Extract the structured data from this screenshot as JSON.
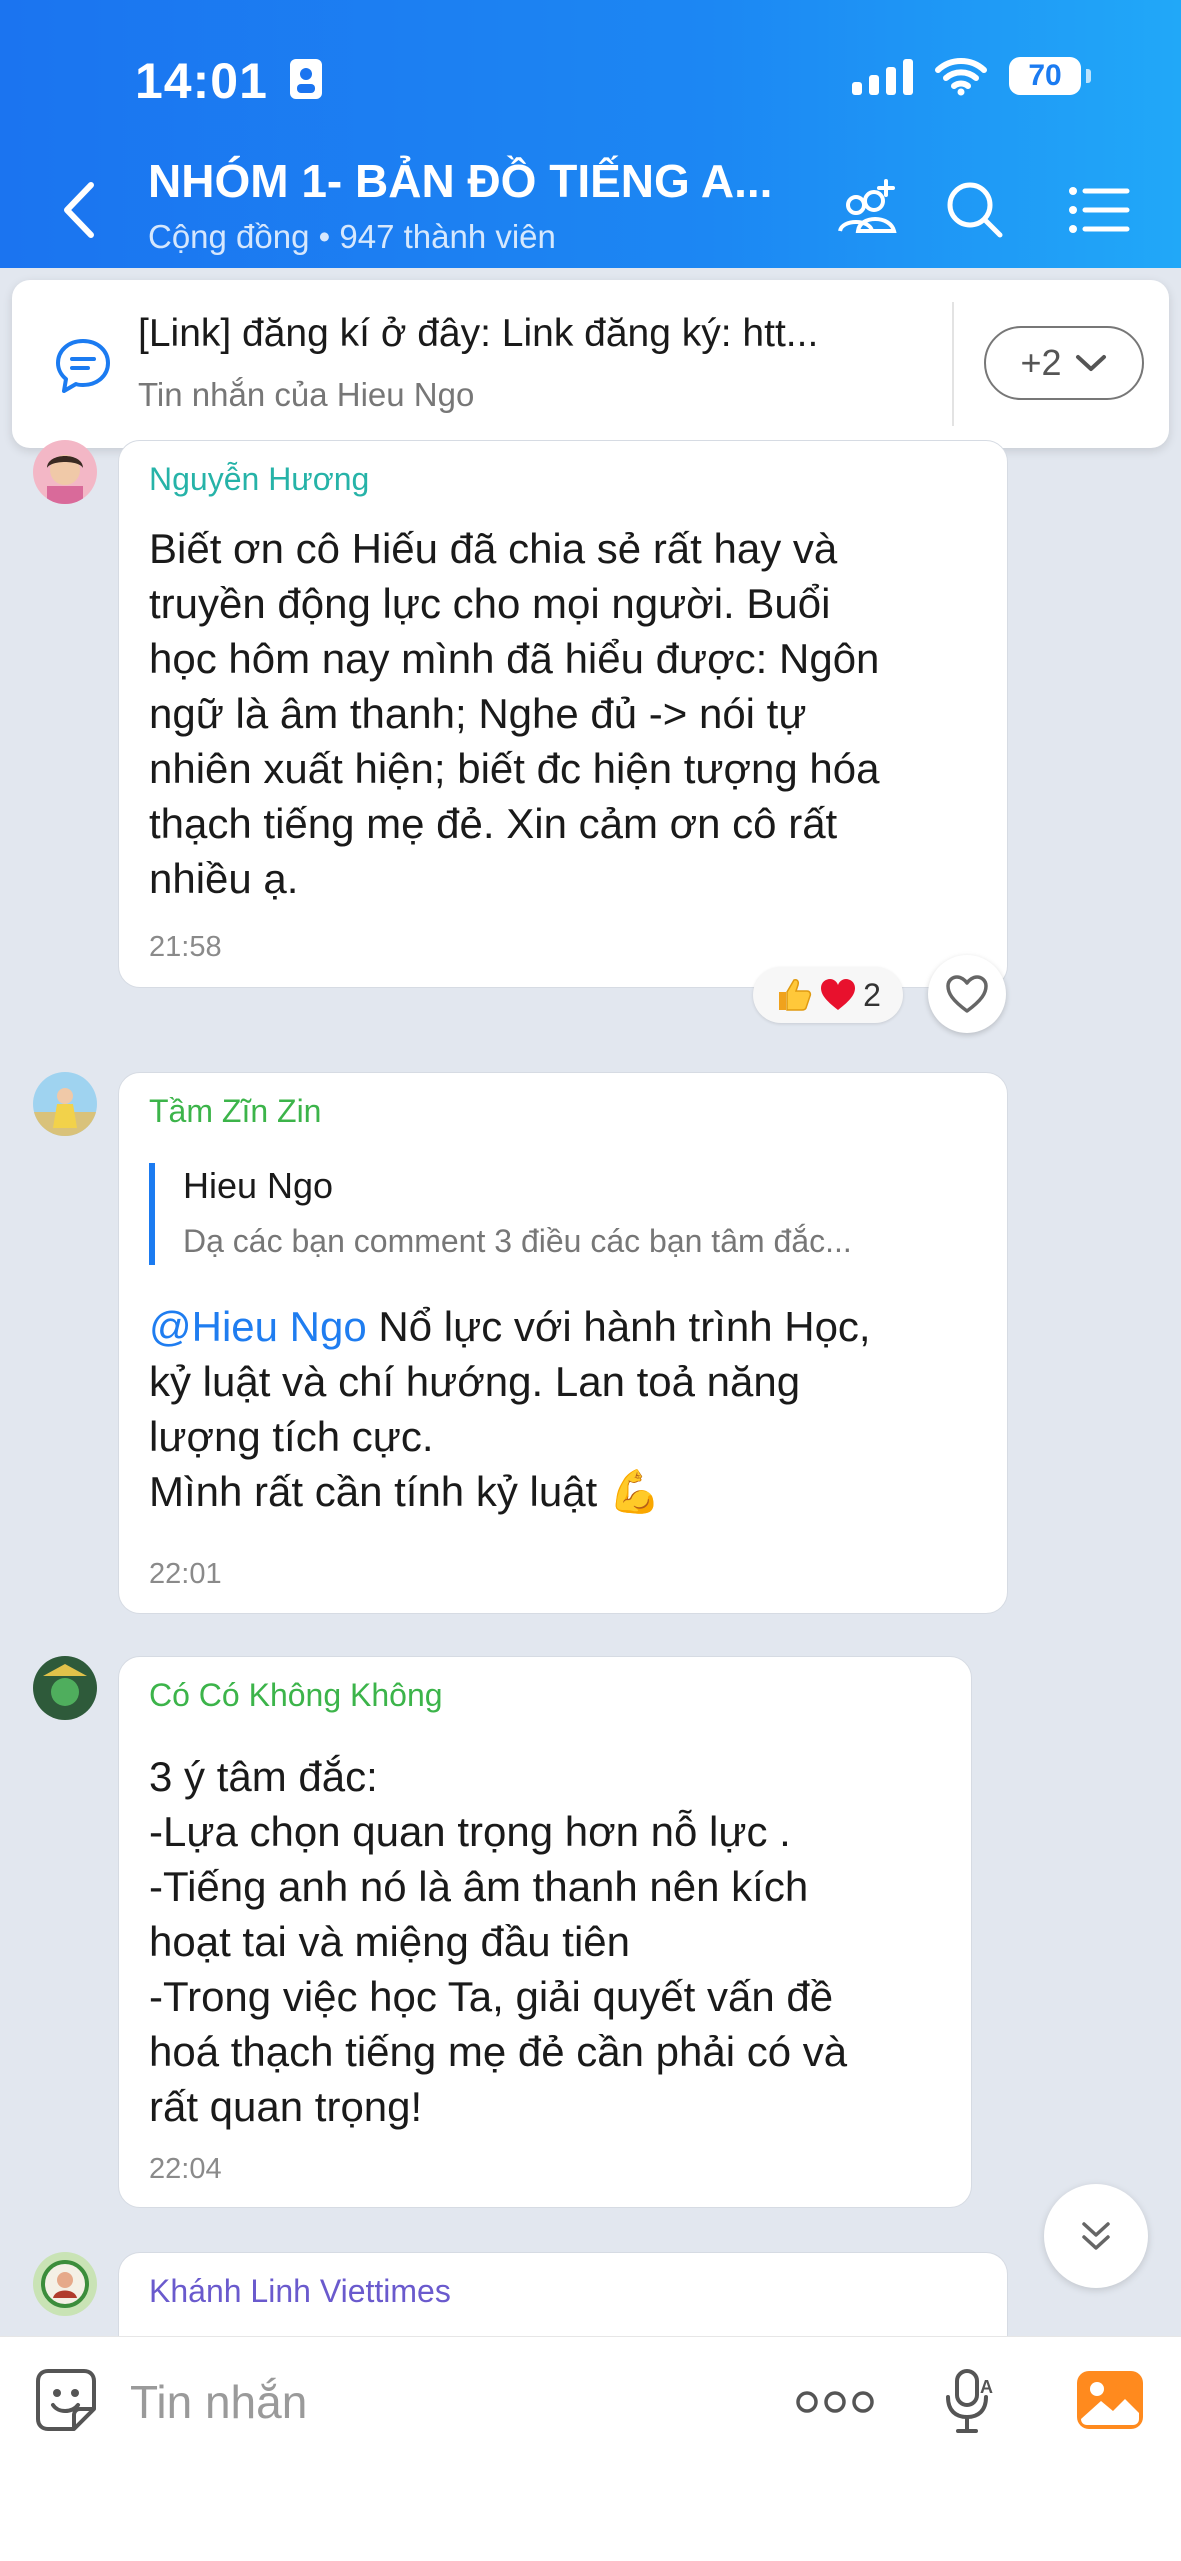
{
  "status_bar": {
    "time": "14:01",
    "battery": "70"
  },
  "header": {
    "title": "NHÓM 1- BẢN ĐỒ TIẾNG A...",
    "subtitle": "Cộng đồng • 947 thành viên"
  },
  "pinned": {
    "title": "[Link] đăng kí ở đây: Link đăng ký: htt...",
    "subtitle": "Tin nhắn của Hieu Ngo",
    "more_label": "+2"
  },
  "messages": [
    {
      "sender": "Nguyễn Hương",
      "lines": [
        "Biết ơn cô Hiếu đã chia sẻ rất hay và",
        "truyền động lực cho mọi người. Buổi",
        "học hôm nay mình đã hiểu được:  Ngôn",
        "ngữ là âm thanh;  Nghe đủ -> nói tự",
        "nhiên xuất hiện; biết đc hiện tượng hóa",
        "thạch tiếng mẹ đẻ. Xin cảm ơn cô rất",
        "nhiều ạ."
      ],
      "time": "21:58",
      "reaction_count": "2"
    },
    {
      "sender": "Tầm Zĩn Zin",
      "quote": {
        "author": "Hieu Ngo",
        "text": "Dạ các bạn comment 3 điều các bạn tâm đắc..."
      },
      "mention": "@Hieu Ngo",
      "lines": [
        " Nổ lực với hành trình Học,",
        "kỷ luật và chí hướng. Lan toả năng",
        "lượng tích cực.",
        "Mình rất cần tính kỷ luật 💪"
      ],
      "time": "22:01"
    },
    {
      "sender": "Có Có Không Không",
      "lines": [
        "3 ý tâm đắc:",
        "-Lựa chọn quan trọng hơn nỗ lực .",
        "-Tiếng anh nó là âm thanh nên kích",
        "hoạt tai và miệng đầu tiên",
        "-Trong việc học Ta, giải quyết vấn đề",
        "hoá thạch tiếng mẹ đẻ cần phải có và",
        "rất quan trọng!"
      ],
      "time": "22:04"
    },
    {
      "sender": "Khánh Linh Viettimes"
    }
  ],
  "composer": {
    "placeholder": "Tin nhắn"
  },
  "colors": {
    "header_start": "#1b74f0",
    "header_end": "#21a8f8",
    "sender_teal": "#26b3a8",
    "sender_green": "#3cb44a",
    "sender_purple": "#6a5acd",
    "mention": "#1f7df0"
  },
  "icons": [
    "back-icon",
    "group-add-icon",
    "search-icon",
    "menu-icon",
    "chat-bubble-icon",
    "chevron-down-icon",
    "heart-icon",
    "thumbs-up-icon",
    "red-heart-icon",
    "double-chevron-down-icon",
    "sticker-icon",
    "more-dots-icon",
    "mic-icon",
    "image-icon"
  ]
}
